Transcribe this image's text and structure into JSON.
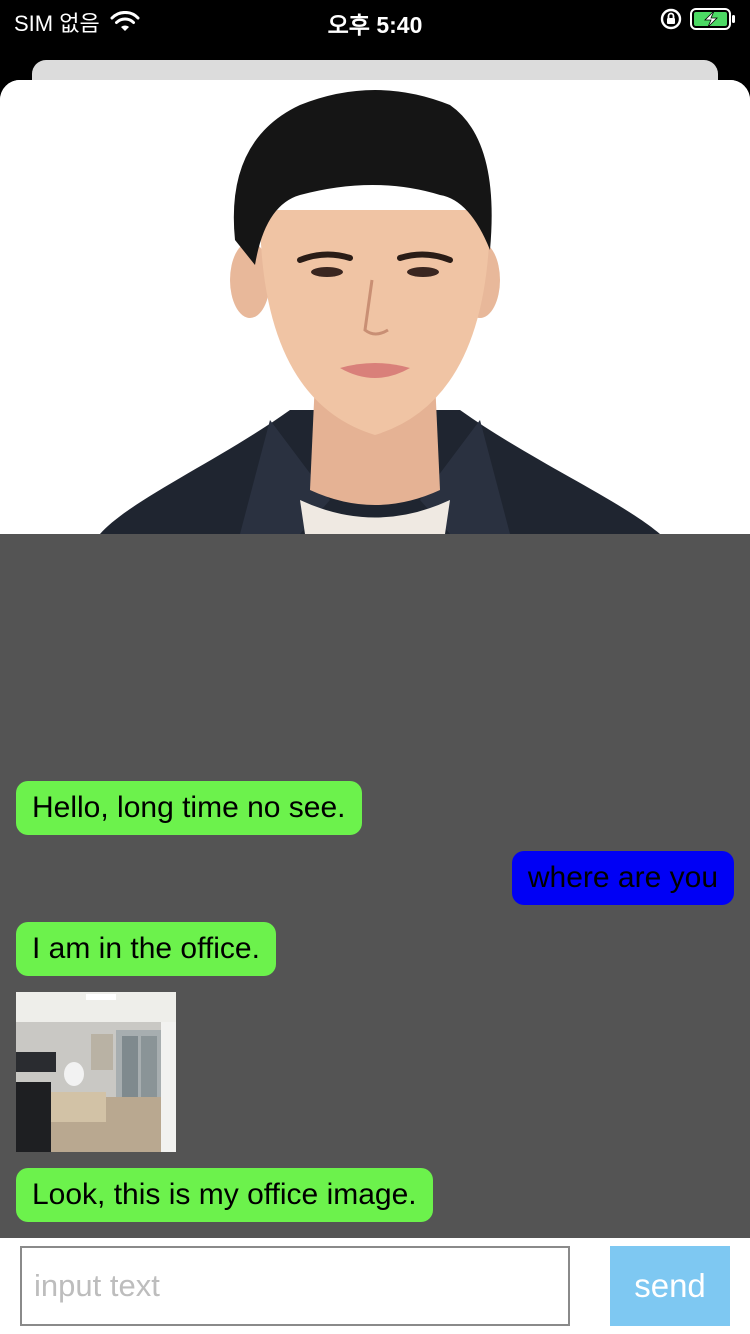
{
  "status_bar": {
    "carrier": "SIM 없음",
    "time": "오후 5:40",
    "icons": [
      "wifi-icon",
      "lock-rotation-icon",
      "battery-charging-icon"
    ],
    "battery_color": "#4cd964"
  },
  "profile": {
    "photo": "profile-photo"
  },
  "messages": [
    {
      "type": "text",
      "side": "left",
      "text": "Hello,  long time no see.",
      "color": "#6cf24c"
    },
    {
      "type": "text",
      "side": "right",
      "text": "where are you",
      "color": "#0000f5"
    },
    {
      "type": "text",
      "side": "left",
      "text": "I am in the office.",
      "color": "#6cf24c"
    },
    {
      "type": "image",
      "side": "left",
      "image": "office-photo"
    },
    {
      "type": "text",
      "side": "left",
      "text": "Look, this is my office image.",
      "color": "#6cf24c"
    }
  ],
  "chat_background": "#545454",
  "composer": {
    "placeholder": "input text",
    "value": "",
    "send_label": "send",
    "send_color": "#7ec8f2"
  }
}
